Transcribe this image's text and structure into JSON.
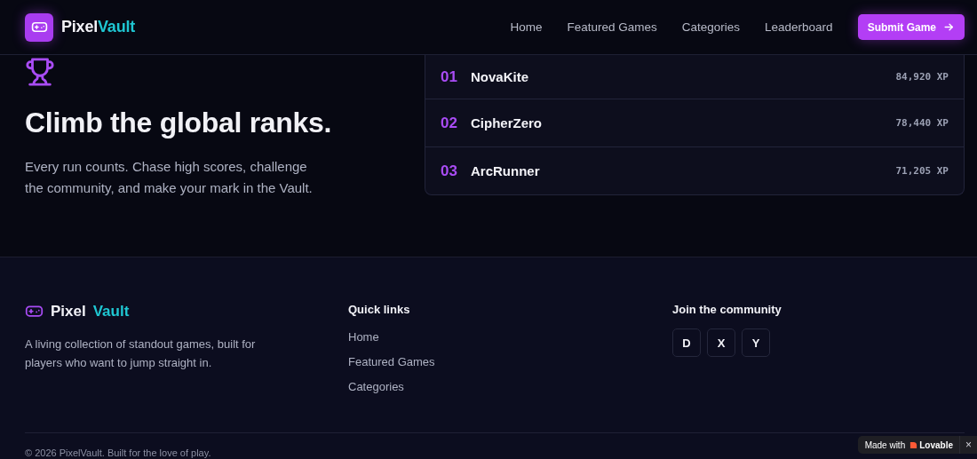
{
  "header": {
    "logo": {
      "first": "Pixel",
      "second": "Vault"
    },
    "nav": [
      {
        "label": "Home"
      },
      {
        "label": "Featured Games"
      },
      {
        "label": "Categories"
      },
      {
        "label": "Leaderboard"
      }
    ],
    "cta": {
      "label": "Submit Game"
    }
  },
  "hero": {
    "title": "Climb the global ranks.",
    "text": "Every run counts. Chase high scores, challenge the community, and make your mark in the Vault."
  },
  "leaderboard": [
    {
      "rank": "01",
      "name": "NovaKite",
      "score": "84,920 XP"
    },
    {
      "rank": "02",
      "name": "CipherZero",
      "score": "78,440 XP"
    },
    {
      "rank": "03",
      "name": "ArcRunner",
      "score": "71,205 XP"
    }
  ],
  "footer": {
    "brand": {
      "first": "Pixel",
      "second": "Vault"
    },
    "about": "A living collection of standout games, built for players who want to jump straight in.",
    "quick_links": {
      "heading": "Quick links",
      "items": [
        "Home",
        "Featured Games",
        "Categories"
      ]
    },
    "community": {
      "heading": "Join the community",
      "socials": [
        "D",
        "X",
        "Y"
      ]
    },
    "copyright": "© 2026 PixelVault. Built for the love of play."
  },
  "badge": {
    "text": "Made with",
    "brand": "Lovable",
    "close": "×"
  }
}
